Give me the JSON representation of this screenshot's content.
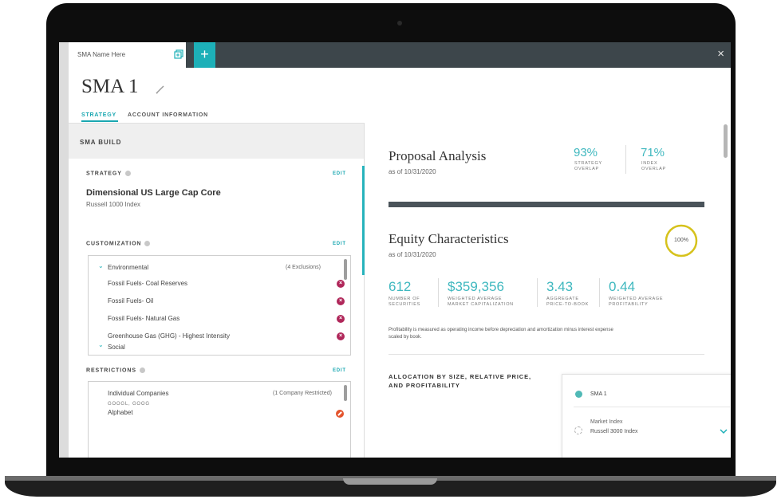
{
  "window": {
    "tab_label": "SMA Name Here",
    "add_tab_symbol": "+",
    "close_symbol": "×"
  },
  "header": {
    "title": "SMA 1",
    "nav": {
      "strategy": "STRATEGY",
      "account": "ACCOUNT INFORMATION"
    }
  },
  "left": {
    "build_header": "SMA BUILD",
    "strategy": {
      "label": "STRATEGY",
      "edit": "EDIT",
      "name": "Dimensional US Large Cap Core",
      "benchmark": "Russell 1000 Index"
    },
    "customization": {
      "label": "CUSTOMIZATION",
      "edit": "EDIT",
      "group": "Environmental",
      "group_note": "(4 Exclusions)",
      "items": [
        "Fossil Fuels- Coal Reserves",
        "Fossil Fuels- Oil",
        "Fossil Fuels- Natural Gas",
        "Greenhouse Gas (GHG) - Highest Intensity"
      ],
      "next_group": "Social"
    },
    "restrictions": {
      "label": "RESTRICTIONS",
      "edit": "EDIT",
      "group": "Individual Companies",
      "group_note": "(1 Company Restricted)",
      "tickers": "GOOGL, GOOG",
      "company": "Alphabet"
    }
  },
  "right": {
    "proposal": {
      "title": "Proposal Analysis",
      "date": "as of 10/31/2020",
      "strategy_overlap_value": "93%",
      "strategy_overlap_label_1": "STRATEGY",
      "strategy_overlap_label_2": "OVERLAP",
      "index_overlap_value": "71%",
      "index_overlap_label_1": "INDEX",
      "index_overlap_label_2": "OVERLAP"
    },
    "equity": {
      "title": "Equity Characteristics",
      "date": "as of 10/31/2020",
      "ring_label": "100%",
      "metrics": [
        {
          "value": "612",
          "label_1": "NUMBER OF",
          "label_2": "SECURITIES"
        },
        {
          "value": "$359,356",
          "label_1": "WEIGHTED AVERAGE",
          "label_2": "MARKET CAPITALIZATION"
        },
        {
          "value": "3.43",
          "label_1": "AGGREGATE",
          "label_2": "PRICE-TO-BOOK"
        },
        {
          "value": "0.44",
          "label_1": "WEIGHTED AVERAGE",
          "label_2": "PROFITABILITY"
        }
      ],
      "footnote_1": "Profitability is measured as operating income before depreciation and amortization minus interest expense",
      "footnote_2": "scaled by book."
    },
    "allocation": {
      "title_1": "ALLOCATION BY SIZE, RELATIVE PRICE,",
      "title_2": "AND PROFITABILITY",
      "legend": {
        "item_1": "SMA 1",
        "item_2_title": "Market Index",
        "item_2_sub": "Russell 3000 Index"
      }
    }
  },
  "colors": {
    "teal": "#1db0b8",
    "topbar": "#3d464b",
    "remove": "#b0275a",
    "restrict": "#e4542d",
    "ring": "#d6c21c"
  }
}
